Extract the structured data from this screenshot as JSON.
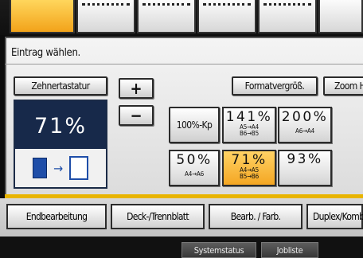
{
  "prompt": "Eintrag wählen.",
  "buttons": {
    "keypad": "Zehnertastatur",
    "plus": "+",
    "minus": "−",
    "format_enlarge": "Formatvergröß.",
    "zoom": "Zoom H"
  },
  "display": {
    "percent": "71%",
    "direction_arrow": "→"
  },
  "presets": {
    "p100": {
      "label": "100%-Kp"
    },
    "p141": {
      "pct": "141%",
      "sub1": "A5→A4",
      "sub2": "B6→B5"
    },
    "p200": {
      "pct": "200%",
      "sub1": "A6→A4"
    },
    "p50": {
      "pct": "50%",
      "sub1": "A4→A6"
    },
    "p71": {
      "pct": "71%",
      "sub1": "A4→A5",
      "sub2": "B5→B6"
    },
    "p93": {
      "pct": "93%"
    }
  },
  "function_tabs": [
    "Endbearbeitung",
    "Deck-/Trennblatt",
    "Bearb. / Farb.",
    "Duplex/Kombi"
  ],
  "status_buttons": [
    "Systemstatus",
    "Jobliste"
  ],
  "colors": {
    "accent_yellow": "#f4a623",
    "display_navy": "#17294a",
    "icon_blue": "#1f4ea8"
  }
}
